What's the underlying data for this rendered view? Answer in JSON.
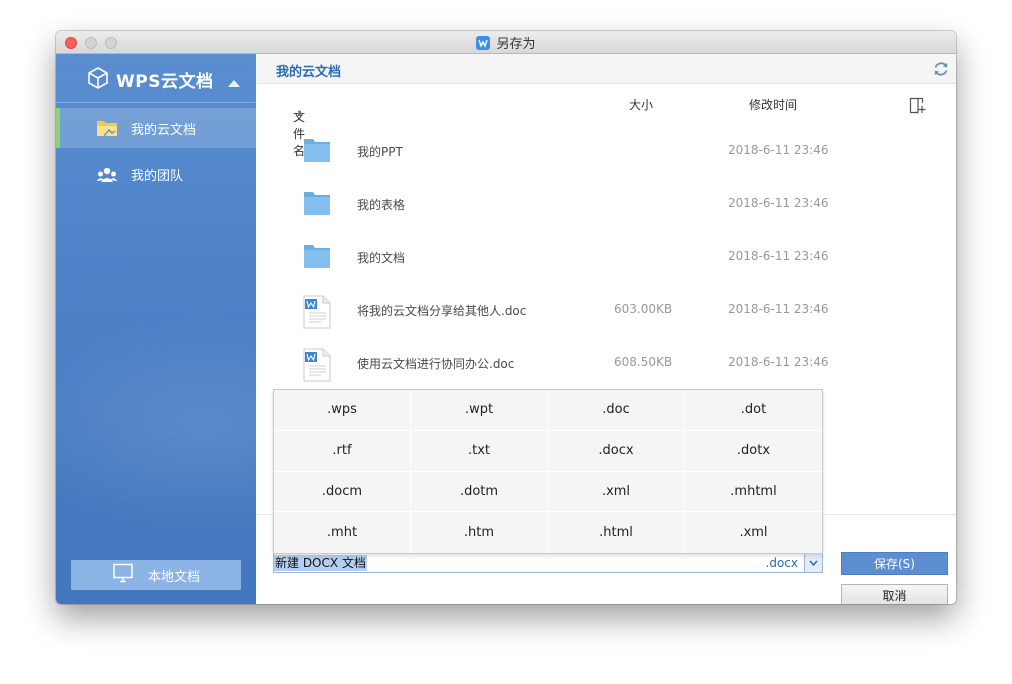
{
  "window": {
    "title": "另存为"
  },
  "sidebar": {
    "brand": "WPS云文档",
    "items": [
      {
        "label": "我的云文档",
        "icon": "folder-icon",
        "active": true
      },
      {
        "label": "我的团队",
        "icon": "team-icon",
        "active": false
      }
    ],
    "local_button": "本地文档"
  },
  "main": {
    "path": "我的云文档",
    "columns": {
      "name": "文件名",
      "size": "大小",
      "modified": "修改时间"
    },
    "files": [
      {
        "name": "我的PPT",
        "size": "",
        "modified": "2018-6-11 23:46",
        "type": "folder"
      },
      {
        "name": "我的表格",
        "size": "",
        "modified": "2018-6-11 23:46",
        "type": "folder"
      },
      {
        "name": "我的文档",
        "size": "",
        "modified": "2018-6-11 23:46",
        "type": "folder"
      },
      {
        "name": "将我的云文档分享给其他人.doc",
        "size": "603.00KB",
        "modified": "2018-6-11 23:46",
        "type": "doc"
      },
      {
        "name": "使用云文档进行协同办公.doc",
        "size": "608.50KB",
        "modified": "2018-6-11 23:46",
        "type": "doc"
      }
    ]
  },
  "extensions": [
    ".wps",
    ".wpt",
    ".doc",
    ".dot",
    ".rtf",
    ".txt",
    ".docx",
    ".dotx",
    ".docm",
    ".dotm",
    ".xml",
    ".mhtml",
    ".mht",
    ".htm",
    ".html",
    ".xml"
  ],
  "save_bar": {
    "filename": "新建 DOCX 文档",
    "extension": ".docx",
    "save_label": "保存(S)",
    "cancel_label": "取消"
  },
  "colors": {
    "sidebar": "#4d82c7",
    "accent": "#2b6cb3",
    "active_marker": "#8ed46b",
    "save_button": "#5b8fd1",
    "folder": "#7ab7e8"
  }
}
